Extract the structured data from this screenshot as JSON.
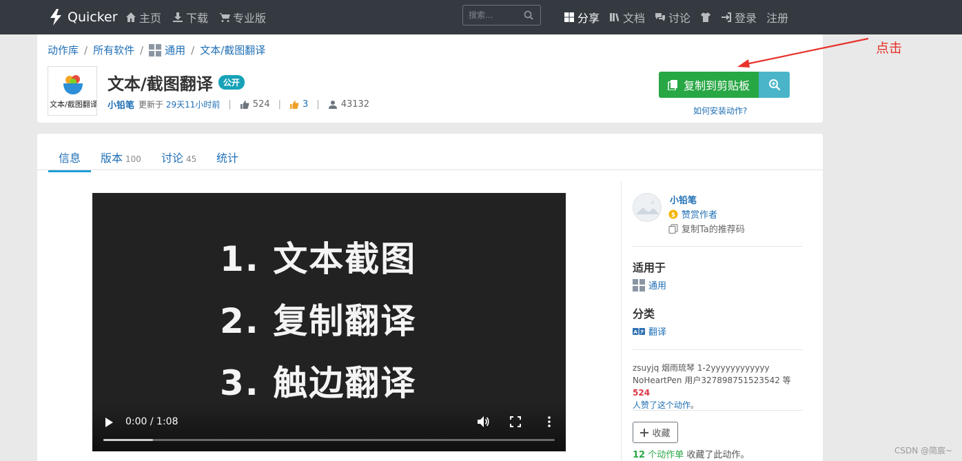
{
  "navbar": {
    "brand": "Quicker",
    "left_items": [
      {
        "label": "主页",
        "icon": "home-icon"
      },
      {
        "label": "下载",
        "icon": "download-icon"
      },
      {
        "label": "专业版",
        "icon": "cart-icon"
      }
    ],
    "search_placeholder": "搜索...",
    "right_items": [
      {
        "label": "分享",
        "icon": "windows-icon",
        "active": true
      },
      {
        "label": "文档",
        "icon": "books-icon"
      },
      {
        "label": "讨论",
        "icon": "chat-icon"
      },
      {
        "label": "",
        "icon": "tshirt-icon"
      },
      {
        "label": "登录",
        "icon": "login-icon"
      },
      {
        "label": "注册",
        "icon": ""
      }
    ]
  },
  "breadcrumb": [
    "动作库",
    "所有软件",
    "通用",
    "文本/截图翻译"
  ],
  "action": {
    "thumbnail_text": "文本/截图翻译",
    "title": "文本/截图翻译",
    "visibility_badge": "公开",
    "author": "小铅笔",
    "updated_prefix": "更新于",
    "updated_time": "29天11小时前",
    "likes": "524",
    "votes": "3",
    "users": "43132",
    "copy_button": "复制到剪贴板",
    "install_link": "如何安装动作?"
  },
  "annotation": {
    "text": "点击",
    "color": "#e8322b"
  },
  "tabs": [
    {
      "label": "信息",
      "count": "",
      "active": true
    },
    {
      "label": "版本",
      "count": "100",
      "active": false
    },
    {
      "label": "讨论",
      "count": "45",
      "active": false
    },
    {
      "label": "统计",
      "count": "",
      "active": false
    }
  ],
  "video": {
    "lines": [
      "1. 文本截图",
      "2. 复制翻译",
      "3. 触边翻译"
    ],
    "time": "0:00 / 1:08",
    "progress": 0.11
  },
  "sidebar": {
    "author_name": "小铅笔",
    "reward_label": "赞赏作者",
    "refcode_label": "复制Ta的推荐码",
    "applies_heading": "适用于",
    "applies_value": "通用",
    "category_heading": "分类",
    "category_value": "翻译",
    "likes_line1": "zsuyjq 烟雨琉琴 1-2yyyyyyyyyyyy",
    "likes_line2_prefix": "NoHeartPen 用户327898751523542 等",
    "likes_count": "524",
    "likes_suffix": "人赞了这个动作",
    "likes_period": "。",
    "fav_button": "收藏",
    "fav_count": "12",
    "fav_link": "个动作单",
    "fav_suffix": "收藏了此动作。"
  },
  "watermark": "CSDN @简宸~",
  "colors": {
    "navbar": "#343a40",
    "primary_green": "#28a745",
    "info_teal": "#17a2b8",
    "link": "#1f6fb5"
  }
}
